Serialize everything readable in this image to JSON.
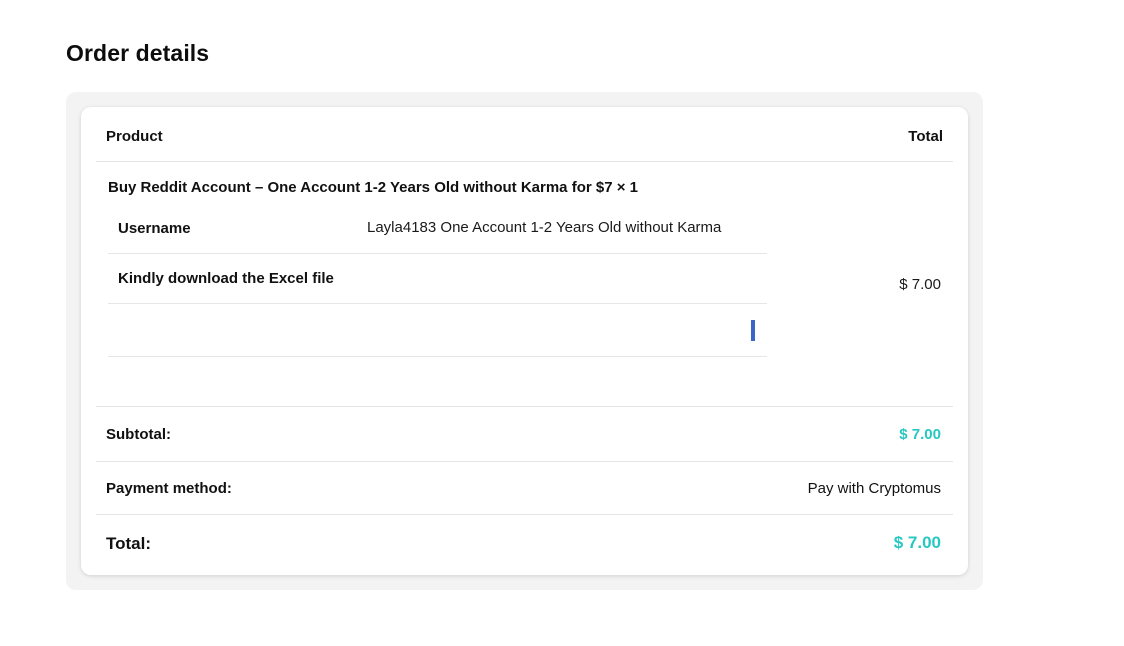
{
  "page": {
    "title": "Order details"
  },
  "table": {
    "header": {
      "product": "Product",
      "total": "Total"
    },
    "item": {
      "title": "Buy Reddit Account – One Account 1-2 Years Old without Karma for $7 × 1",
      "meta": [
        {
          "label": "Username",
          "value": "Layla4183 One Account 1-2 Years Old without Karma"
        },
        {
          "label": "Kindly download the Excel file",
          "value": ""
        }
      ],
      "total": "$ 7.00"
    },
    "subtotal": {
      "label": "Subtotal:",
      "value": "$ 7.00"
    },
    "payment": {
      "label": "Payment method:",
      "value": "Pay with Cryptomus"
    },
    "grand_total": {
      "label": "Total:",
      "value": "$ 7.00"
    }
  },
  "colors": {
    "accent": "#27c7c2",
    "file_bar": "#3a67c7"
  }
}
